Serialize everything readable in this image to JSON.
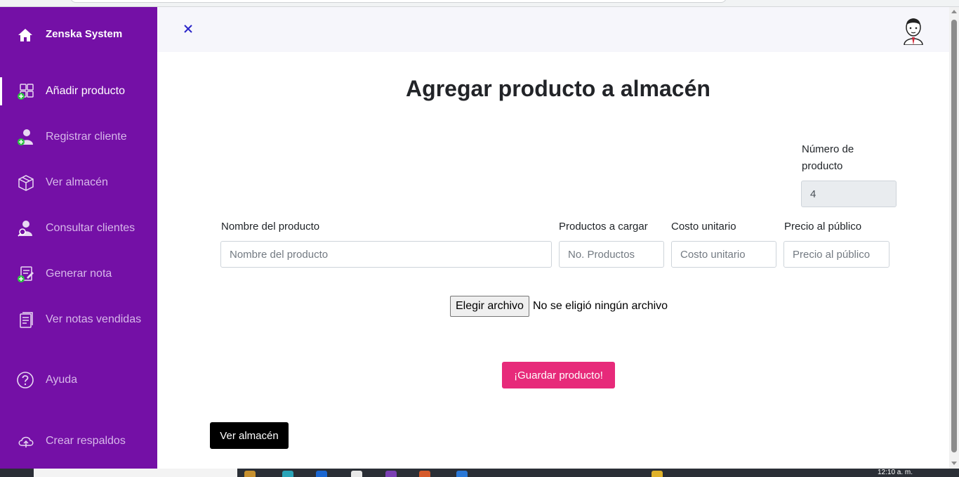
{
  "brand": {
    "name": "Zenska System"
  },
  "sidebar": {
    "items": [
      {
        "label": "Añadir producto",
        "icon": "add-product-icon",
        "active": true
      },
      {
        "label": "Registrar cliente",
        "icon": "add-user-icon"
      },
      {
        "label": "Ver almacén",
        "icon": "box-icon"
      },
      {
        "label": "Consultar clientes",
        "icon": "search-user-icon"
      },
      {
        "label": "Generar nota",
        "icon": "edit-note-icon"
      },
      {
        "label": "Ver notas vendidas",
        "icon": "notes-icon"
      },
      {
        "label": "Ayuda",
        "icon": "help-icon"
      },
      {
        "label": "Crear respaldos",
        "icon": "cloud-upload-icon"
      }
    ]
  },
  "topbar": {
    "close_icon": "close-icon",
    "avatar_icon": "avatar-icon"
  },
  "page": {
    "title": "Agregar producto a almacén"
  },
  "form": {
    "numero": {
      "label": "Número de producto",
      "value": "4"
    },
    "nombre": {
      "label": "Nombre del producto",
      "placeholder": "Nombre del producto"
    },
    "cantidad": {
      "label": "Productos a cargar",
      "placeholder": "No. Productos"
    },
    "costo": {
      "label": "Costo unitario",
      "placeholder": "Costo unitario"
    },
    "precio": {
      "label": "Precio al público",
      "placeholder": "Precio al público"
    },
    "file": {
      "button_label": "Elegir archivo",
      "status": "No se eligió ningún archivo"
    },
    "save_label": "¡Guardar producto!"
  },
  "footer": {
    "warehouse_label": "Ver almacén"
  },
  "taskbar": {
    "clock": "12:10 a. m."
  },
  "colors": {
    "sidebar_bg": "#7410a6",
    "accent_pink": "#e72a7a",
    "close_blue": "#2a25c8",
    "new_badge": "#2fc145"
  }
}
